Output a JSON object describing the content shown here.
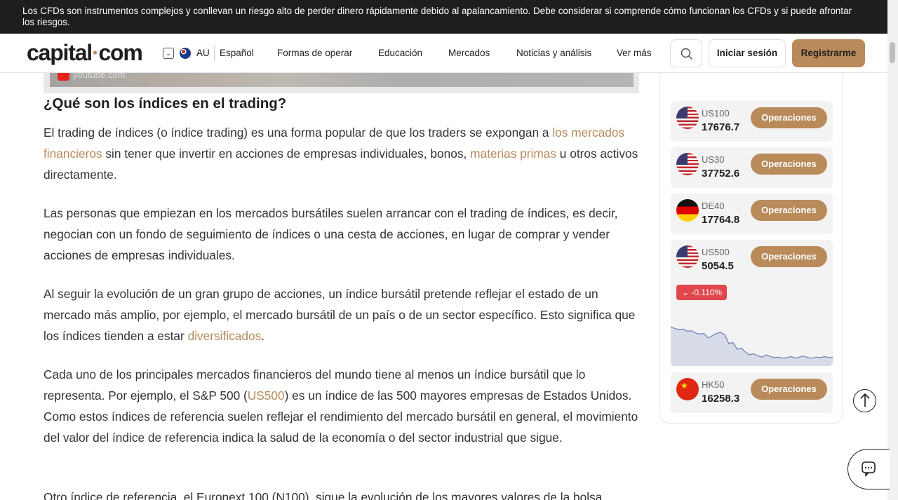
{
  "risk_banner": {
    "text": "Los CFDs son instrumentos complejos y conllevan un riesgo alto de perder dinero rápidamente debido al apalancamiento. Debe considerar si comprende cómo funcionan los CFDs y si puede afrontar los riesgos."
  },
  "header": {
    "logo_main": "capital",
    "logo_dot": "·",
    "logo_end": "com",
    "region": "AU",
    "language": "Español",
    "nav": [
      "Formas de operar",
      "Educación",
      "Mercados",
      "Noticias y análisis",
      "Ver más"
    ],
    "login": "Iniciar sesión",
    "signup": "Registrarme"
  },
  "video": {
    "source": "youtube.com"
  },
  "article": {
    "title": "¿Qué son los índices en el trading?",
    "p1": {
      "a": "El trading de índices (o índice trading) es una forma popular de que los traders se expongan a ",
      "link1": "los mercados financieros",
      "b": " sin tener que invertir en acciones de empresas individuales, bonos, ",
      "link2": "materias primas",
      "c": " u otros activos directamente."
    },
    "p2": "Las personas que empiezan en los mercados bursátiles suelen arrancar con el trading de índices, es decir, negocian con un fondo de seguimiento de índices o una cesta de acciones, en lugar de comprar y vender acciones de empresas individuales.",
    "p3": {
      "a": "Al seguir la evolución de un gran grupo de acciones, un índice bursátil pretende reflejar el estado de un mercado más amplio, por ejemplo, el mercado bursátil de un país o de un sector específico. Esto significa que los índices tienden a estar ",
      "link": "diversificados",
      "b": "."
    },
    "p4": {
      "a": "Cada uno de los principales mercados financieros del mundo tiene al menos un índice bursátil que lo representa. Por ejemplo, el S&P 500 (",
      "link": "US500",
      "b": ") es un índice de las 500 mayores empresas de Estados Unidos. Como estos índices de referencia suelen reflejar el rendimiento del mercado bursátil en general, el movimiento del valor del índice de referencia indica la salud de la economía o del sector industrial que sigue."
    },
    "p5": "Otro índice de referencia, el Euronext 100 (N100), sigue la evolución de los mayores valores de la bolsa"
  },
  "sidebar": {
    "button_label": "Operaciones",
    "instruments": [
      {
        "symbol": "US100",
        "price": "17676.7",
        "flag": "us-flag-icon"
      },
      {
        "symbol": "US30",
        "price": "37752.6",
        "flag": "us-flag-icon"
      },
      {
        "symbol": "DE40",
        "price": "17764.8",
        "flag": "de-flag-icon"
      },
      {
        "symbol": "US500",
        "price": "5054.5",
        "flag": "us-flag-icon",
        "change": "-0.110%"
      },
      {
        "symbol": "HK50",
        "price": "16258.3",
        "flag": "cn-flag-icon"
      }
    ],
    "sparkline": [
      30,
      33,
      35,
      34,
      38,
      37,
      41,
      43,
      42,
      50,
      46,
      42,
      40,
      44,
      60,
      58,
      70,
      68,
      75,
      80,
      78,
      82,
      84,
      80,
      83,
      85,
      84,
      86,
      85,
      83,
      86,
      84,
      82,
      85,
      86,
      84,
      85,
      83,
      85,
      84
    ]
  },
  "colors": {
    "accent": "#b98a5a",
    "negative": "#e0464b",
    "banner": "#1e1e1e"
  },
  "icons": {
    "search": "search-icon",
    "back_to_top": "arrow-up-icon",
    "chat": "chat-icon",
    "chevron": "chevron-down-icon"
  }
}
